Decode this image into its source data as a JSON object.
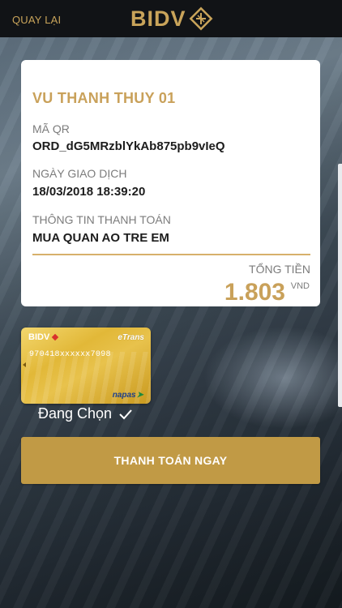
{
  "header": {
    "back_label": "QUAY LẠI",
    "brand": "BIDV"
  },
  "transaction": {
    "payee": "VU THANH THUY 01",
    "qr_label": "MÃ QR",
    "qr_value": "ORD_dG5MRzblYkAb875pb9vIeQ",
    "date_label": "NGÀY GIAO DỊCH",
    "date_value": "18/03/2018 18:39:20",
    "info_label": "THÔNG TIN THANH TOÁN",
    "info_value": "MUA QUAN AO TRE EM",
    "total_label": "TỔNG TIỀN",
    "total_amount": "1.803",
    "total_currency": "VND"
  },
  "card": {
    "bank": "BIDV",
    "product": "eTrans",
    "number": "970418xxxxxx7098",
    "network": "napas"
  },
  "selection": {
    "label": "Đang Chọn"
  },
  "actions": {
    "pay_label": "THANH TOÁN NGAY"
  },
  "colors": {
    "accent_gold": "#c9a45a",
    "button_gold": "#c19a45",
    "header_bg": "#111316"
  }
}
